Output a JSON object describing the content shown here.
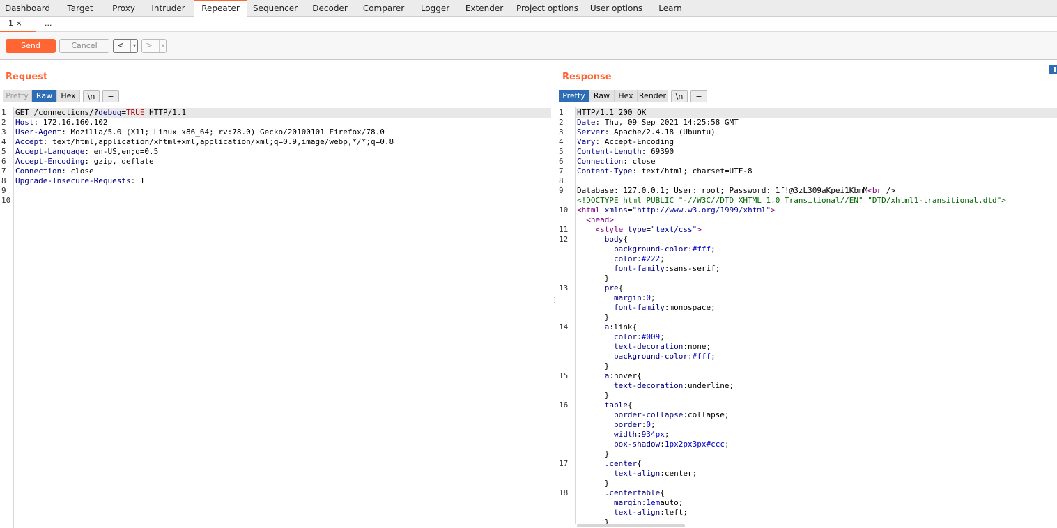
{
  "main_tabs": [
    {
      "label": "Dashboard",
      "active": false
    },
    {
      "label": "Target",
      "active": false
    },
    {
      "label": "Proxy",
      "active": false
    },
    {
      "label": "Intruder",
      "active": false
    },
    {
      "label": "Repeater",
      "active": true
    },
    {
      "label": "Sequencer",
      "active": false
    },
    {
      "label": "Decoder",
      "active": false
    },
    {
      "label": "Comparer",
      "active": false
    },
    {
      "label": "Logger",
      "active": false
    },
    {
      "label": "Extender",
      "active": false
    },
    {
      "label": "Project options",
      "active": false
    },
    {
      "label": "User options",
      "active": false
    },
    {
      "label": "Learn",
      "active": false
    }
  ],
  "sub_tabs": [
    {
      "label": "1 ×",
      "active": true
    },
    {
      "label": "...",
      "active": false
    }
  ],
  "toolbar": {
    "send_label": "Send",
    "cancel_label": "Cancel",
    "back_label": "<",
    "forward_label": ">",
    "dropdown_glyph": "▾"
  },
  "request": {
    "title": "Request",
    "view_buttons": [
      "Pretty",
      "Raw",
      "Hex",
      "\\n",
      "≡"
    ],
    "active_view": "Raw",
    "line_numbers": [
      "1",
      "2",
      "3",
      "4",
      "5",
      "6",
      "7",
      "8",
      "9",
      "10"
    ],
    "lines": [
      [
        [
          "",
          "GET /connections/?"
        ],
        [
          "k",
          "debug"
        ],
        [
          "",
          "="
        ],
        [
          "v",
          "TRUE"
        ],
        [
          "",
          " HTTP/1.1"
        ]
      ],
      [
        [
          "k",
          "Host"
        ],
        [
          "",
          ": 172.16.160.102"
        ]
      ],
      [
        [
          "k",
          "User-Agent"
        ],
        [
          "",
          ": Mozilla/5.0 (X11; Linux x86_64; rv:78.0) Gecko/20100101 Firefox/78.0"
        ]
      ],
      [
        [
          "k",
          "Accept"
        ],
        [
          "",
          ": text/html,application/xhtml+xml,application/xml;q=0.9,image/webp,*/*;q=0.8"
        ]
      ],
      [
        [
          "k",
          "Accept-Language"
        ],
        [
          "",
          ": en-US,en;q=0.5"
        ]
      ],
      [
        [
          "k",
          "Accept-Encoding"
        ],
        [
          "",
          ": gzip, deflate"
        ]
      ],
      [
        [
          "k",
          "Connection"
        ],
        [
          "",
          ": close"
        ]
      ],
      [
        [
          "k",
          "Upgrade-Insecure-Requests"
        ],
        [
          "",
          ": 1"
        ]
      ],
      [
        [
          "",
          ""
        ]
      ],
      [
        [
          "",
          ""
        ]
      ]
    ]
  },
  "response": {
    "title": "Response",
    "view_buttons": [
      "Pretty",
      "Raw",
      "Hex",
      "Render",
      "\\n",
      "≡"
    ],
    "active_view": "Pretty",
    "line_numbers": [
      {
        "n": "1",
        "row": 0
      },
      {
        "n": "2",
        "row": 1
      },
      {
        "n": "3",
        "row": 2
      },
      {
        "n": "4",
        "row": 3
      },
      {
        "n": "5",
        "row": 4
      },
      {
        "n": "6",
        "row": 5
      },
      {
        "n": "7",
        "row": 6
      },
      {
        "n": "8",
        "row": 7
      },
      {
        "n": "9",
        "row": 8
      },
      {
        "n": "10",
        "row": 10
      },
      {
        "n": "11",
        "row": 12
      },
      {
        "n": "12",
        "row": 13
      },
      {
        "n": "13",
        "row": 18
      },
      {
        "n": "14",
        "row": 22
      },
      {
        "n": "15",
        "row": 27
      },
      {
        "n": "16",
        "row": 30
      },
      {
        "n": "17",
        "row": 36
      },
      {
        "n": "18",
        "row": 39
      }
    ],
    "lines": [
      [
        [
          "",
          "HTTP/1.1 200 OK"
        ]
      ],
      [
        [
          "k",
          "Date"
        ],
        [
          "",
          ": Thu, 09 Sep 2021 14:25:58 GMT"
        ]
      ],
      [
        [
          "k",
          "Server"
        ],
        [
          "",
          ": Apache/2.4.18 (Ubuntu)"
        ]
      ],
      [
        [
          "k",
          "Vary"
        ],
        [
          "",
          ": Accept-Encoding"
        ]
      ],
      [
        [
          "k",
          "Content-Length"
        ],
        [
          "",
          ": 69390"
        ]
      ],
      [
        [
          "k",
          "Connection"
        ],
        [
          "",
          ": close"
        ]
      ],
      [
        [
          "k",
          "Content-Type"
        ],
        [
          "",
          ": text/html; charset=UTF-8"
        ]
      ],
      [
        [
          "",
          ""
        ]
      ],
      [
        [
          "",
          "Database: 127.0.0.1; User: root; Password: 1f!@3zL309aKpei1KbmM"
        ],
        [
          "tag",
          "<br"
        ],
        [
          "",
          " />"
        ]
      ],
      [
        [
          "dtd",
          "<!DOCTYPE html PUBLIC \"-//W3C//DTD XHTML 1.0 Transitional//EN\" \"DTD/xhtml1-transitional.dtd\">"
        ]
      ],
      [
        [
          "tag",
          "<html"
        ],
        [
          "",
          " "
        ],
        [
          "attr",
          "xmlns"
        ],
        [
          "",
          "="
        ],
        [
          "str",
          "\"http://www.w3.org/1999/xhtml\""
        ],
        [
          "tag",
          ">"
        ]
      ],
      [
        [
          "",
          "  "
        ],
        [
          "tag",
          "<head>"
        ]
      ],
      [
        [
          "",
          "    "
        ],
        [
          "tag",
          "<style"
        ],
        [
          "",
          " "
        ],
        [
          "attr",
          "type"
        ],
        [
          "",
          "="
        ],
        [
          "str",
          "\"text/css\""
        ],
        [
          "tag",
          ">"
        ]
      ],
      [
        [
          "",
          "      "
        ],
        [
          "attr",
          "body"
        ],
        [
          "",
          "{"
        ]
      ],
      [
        [
          "",
          "        "
        ],
        [
          "attr",
          "background-color"
        ],
        [
          "",
          ":"
        ],
        [
          "cval",
          "#fff"
        ],
        [
          "",
          ";"
        ]
      ],
      [
        [
          "",
          "        "
        ],
        [
          "attr",
          "color"
        ],
        [
          "",
          ":"
        ],
        [
          "cval",
          "#222"
        ],
        [
          "",
          ";"
        ]
      ],
      [
        [
          "",
          "        "
        ],
        [
          "attr",
          "font-family"
        ],
        [
          "",
          ":sans-serif;"
        ]
      ],
      [
        [
          "",
          "      }"
        ]
      ],
      [
        [
          "",
          "      "
        ],
        [
          "attr",
          "pre"
        ],
        [
          "",
          "{"
        ]
      ],
      [
        [
          "",
          "        "
        ],
        [
          "attr",
          "margin"
        ],
        [
          "",
          ":"
        ],
        [
          "cval",
          "0"
        ],
        [
          "",
          ";"
        ]
      ],
      [
        [
          "",
          "        "
        ],
        [
          "attr",
          "font-family"
        ],
        [
          "",
          ":monospace;"
        ]
      ],
      [
        [
          "",
          "      }"
        ]
      ],
      [
        [
          "",
          "      "
        ],
        [
          "attr",
          "a"
        ],
        [
          "",
          ":link{"
        ]
      ],
      [
        [
          "",
          "        "
        ],
        [
          "attr",
          "color"
        ],
        [
          "",
          ":"
        ],
        [
          "cval",
          "#009"
        ],
        [
          "",
          ";"
        ]
      ],
      [
        [
          "",
          "        "
        ],
        [
          "attr",
          "text-decoration"
        ],
        [
          "",
          ":none;"
        ]
      ],
      [
        [
          "",
          "        "
        ],
        [
          "attr",
          "background-color"
        ],
        [
          "",
          ":"
        ],
        [
          "cval",
          "#fff"
        ],
        [
          "",
          ";"
        ]
      ],
      [
        [
          "",
          "      }"
        ]
      ],
      [
        [
          "",
          "      "
        ],
        [
          "attr",
          "a"
        ],
        [
          "",
          ":hover{"
        ]
      ],
      [
        [
          "",
          "        "
        ],
        [
          "attr",
          "text-decoration"
        ],
        [
          "",
          ":underline;"
        ]
      ],
      [
        [
          "",
          "      }"
        ]
      ],
      [
        [
          "",
          "      "
        ],
        [
          "attr",
          "table"
        ],
        [
          "",
          "{"
        ]
      ],
      [
        [
          "",
          "        "
        ],
        [
          "attr",
          "border-collapse"
        ],
        [
          "",
          ":collapse;"
        ]
      ],
      [
        [
          "",
          "        "
        ],
        [
          "attr",
          "border"
        ],
        [
          "",
          ":"
        ],
        [
          "cval",
          "0"
        ],
        [
          "",
          ";"
        ]
      ],
      [
        [
          "",
          "        "
        ],
        [
          "attr",
          "width"
        ],
        [
          "",
          ":"
        ],
        [
          "cval",
          "934px"
        ],
        [
          "",
          ";"
        ]
      ],
      [
        [
          "",
          "        "
        ],
        [
          "attr",
          "box-shadow"
        ],
        [
          "",
          ":"
        ],
        [
          "cval",
          "1px2px3px#ccc"
        ],
        [
          "",
          ";"
        ]
      ],
      [
        [
          "",
          "      }"
        ]
      ],
      [
        [
          "",
          "      "
        ],
        [
          "attr",
          ".center"
        ],
        [
          "",
          "{"
        ]
      ],
      [
        [
          "",
          "        "
        ],
        [
          "attr",
          "text-align"
        ],
        [
          "",
          ":center;"
        ]
      ],
      [
        [
          "",
          "      }"
        ]
      ],
      [
        [
          "",
          "      "
        ],
        [
          "attr",
          ".centertable"
        ],
        [
          "",
          "{"
        ]
      ],
      [
        [
          "",
          "        "
        ],
        [
          "attr",
          "margin"
        ],
        [
          "",
          ":"
        ],
        [
          "cval",
          "1em"
        ],
        [
          "",
          "auto;"
        ]
      ],
      [
        [
          "",
          "        "
        ],
        [
          "attr",
          "text-align"
        ],
        [
          "",
          ":left;"
        ]
      ],
      [
        [
          "",
          "      }"
        ]
      ]
    ]
  },
  "colors": {
    "accent": "#ff6633",
    "active_view": "#2d6db5",
    "header_key": "#000080",
    "param_value": "#b00000",
    "tag": "#800080",
    "doctype": "#006400"
  },
  "icons": {
    "splitter": "drag-handle-icon",
    "layout_toggle": "layout-toggle-icon",
    "menu": "hamburger-icon"
  }
}
